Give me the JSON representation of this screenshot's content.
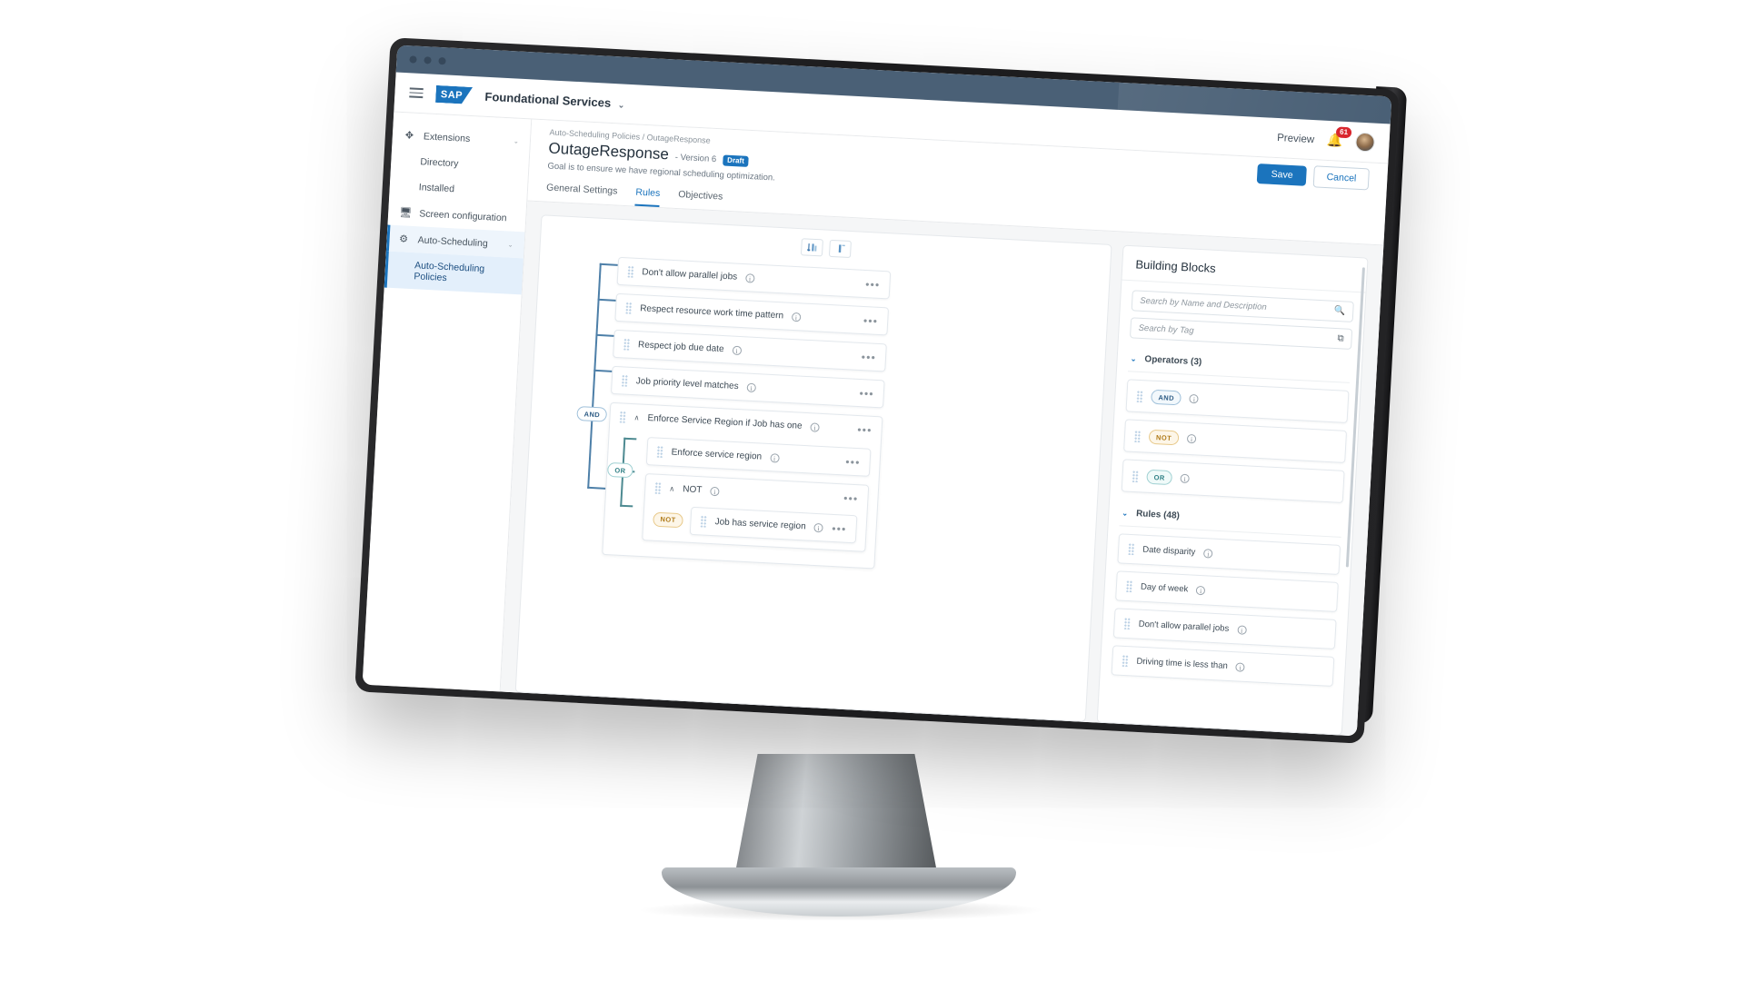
{
  "browser": {
    "window_dots": 3
  },
  "header": {
    "menu_icon": "hamburger-icon",
    "logo_text": "SAP",
    "app_title": "Foundational Services",
    "app_title_caret": "⌄",
    "preview_label": "Preview",
    "bell_icon": "bell-icon",
    "notification_count": "61",
    "avatar": "user-avatar"
  },
  "sidebar": {
    "items": [
      {
        "label": "Extensions",
        "icon": "extensions-icon",
        "caret": "⌄",
        "state": "expandable",
        "indent": false
      },
      {
        "label": "Directory",
        "icon": "",
        "caret": "",
        "state": "normal",
        "indent": true
      },
      {
        "label": "Installed",
        "icon": "",
        "caret": "",
        "state": "normal",
        "indent": true
      },
      {
        "label": "Screen configuration",
        "icon": "monitor-icon",
        "caret": "",
        "state": "normal",
        "indent": false
      },
      {
        "label": "Auto-Scheduling",
        "icon": "gear-icon",
        "caret": "⌄",
        "state": "active-parent",
        "indent": false
      },
      {
        "label": "Auto-Scheduling Policies",
        "icon": "",
        "caret": "",
        "state": "active-child",
        "indent": true
      }
    ]
  },
  "page": {
    "breadcrumb": "Auto-Scheduling Policies / OutageResponse",
    "title": "OutageResponse",
    "version": "- Version 6",
    "status_badge": "Draft",
    "goal": "Goal is to ensure we have regional scheduling optimization.",
    "save_label": "Save",
    "cancel_label": "Cancel",
    "tabs": [
      {
        "label": "General Settings",
        "active": false
      },
      {
        "label": "Rules",
        "active": true
      },
      {
        "label": "Objectives",
        "active": false
      }
    ]
  },
  "canvas": {
    "toolbar": [
      {
        "name": "sort-order-button",
        "icon": "sort-icon"
      },
      {
        "name": "tree-layout-button",
        "icon": "hierarchy-icon"
      }
    ],
    "root_operator": "AND",
    "nested_operator": "OR",
    "inline_not": "NOT",
    "info_icon": "info-icon",
    "more_icon": "•••",
    "collapse_caret": "∧",
    "rules": [
      {
        "label": "Don't allow parallel jobs"
      },
      {
        "label": "Respect resource work time pattern"
      },
      {
        "label": "Respect job due date"
      },
      {
        "label": "Job priority level matches"
      }
    ],
    "group": {
      "label": "Enforce Service Region if Job has one",
      "children": [
        {
          "label": "Enforce service region",
          "type": "rule"
        },
        {
          "label": "NOT",
          "type": "operator-group"
        },
        {
          "label": "Job has service region",
          "type": "rule",
          "prefix": "NOT"
        }
      ]
    }
  },
  "building_blocks": {
    "title": "Building Blocks",
    "search_name_placeholder": "Search by Name and Description",
    "search_name_value": "",
    "search_name_icon": "search-icon",
    "search_tag_placeholder": "Search by Tag",
    "search_tag_value": "",
    "search_tag_icon": "tag-icon",
    "sections": [
      {
        "label": "Operators (3)",
        "caret": "⌄",
        "items": [
          {
            "chip": "AND",
            "chip_class": "op-and"
          },
          {
            "chip": "NOT",
            "chip_class": "op-not"
          },
          {
            "chip": "OR",
            "chip_class": "op-or"
          }
        ]
      },
      {
        "label": "Rules (48)",
        "caret": "⌄",
        "items": [
          {
            "label": "Date disparity"
          },
          {
            "label": "Day of week"
          },
          {
            "label": "Don't allow parallel jobs"
          },
          {
            "label": "Driving time is less than"
          }
        ]
      }
    ]
  }
}
